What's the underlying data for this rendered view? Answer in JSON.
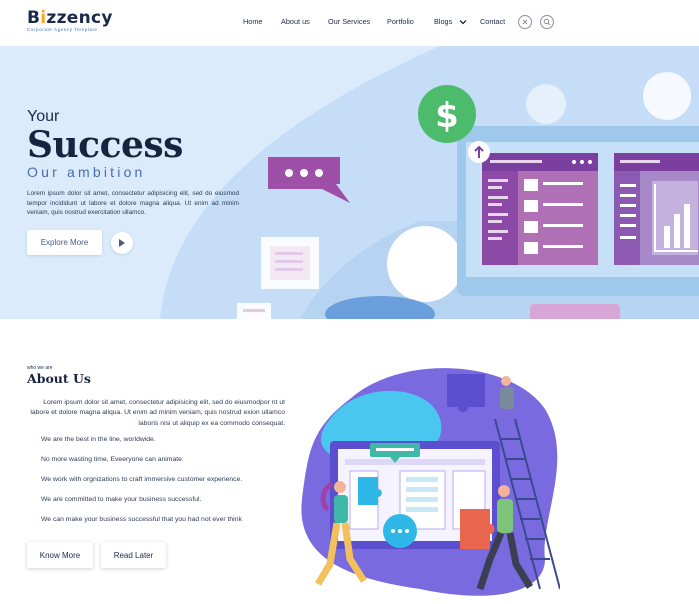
{
  "brand": {
    "name_prefix": "B",
    "name_accent": "i",
    "name_suffix": "zzency",
    "tagline": "Corporate Agency Template"
  },
  "nav": {
    "items": [
      {
        "label": "Home"
      },
      {
        "label": "About us"
      },
      {
        "label": "Our Services"
      },
      {
        "label": "Portfolio"
      },
      {
        "label": "Blogs"
      },
      {
        "label": "Contact"
      }
    ],
    "close_icon": "close-icon",
    "search_icon": "search-icon"
  },
  "hero": {
    "line1": "Your",
    "line2": "Success",
    "line3": "Our ambition",
    "text": "Lorem ipsum dolor sit amet, consectetur adipisicing elit, sed do eiusmod tempor incididunt ut labore et dolore magna aliqua. Ut enim ad minim veniam, quis nostrud exercitation ullamco.",
    "explore_label": "Explore More",
    "play_icon": "play-icon"
  },
  "about": {
    "eyebrow": "who we are",
    "title": "About Us",
    "paragraph": "Lorem ipsum dolor sit amet, consectetur adipisicing elit, sed do eiusmodpor nt ut labore et dolore magna aliqua. Ut enim ad minim veniam, quis nostrud exion ullamco laboris nisi ut aliquip ex ea commodo consequat.",
    "points": [
      "We are the best in the line, worldwide.",
      "No more wasting time, Eveeryone can animate.",
      "We work with orgnizations to craft immersive customer experience.",
      "We are committed to make your business successful.",
      "We can make your business successful that you had not ever think"
    ],
    "know_more_label": "Know More",
    "read_later_label": "Read Later"
  },
  "colors": {
    "navy": "#17243f",
    "hero_bg": "#dcebfb",
    "accent_purple": "#7b3fa0",
    "accent_green": "#4cbb6c",
    "illus_purple": "#7a6ae0",
    "illus_cyan": "#4ac7f0"
  }
}
